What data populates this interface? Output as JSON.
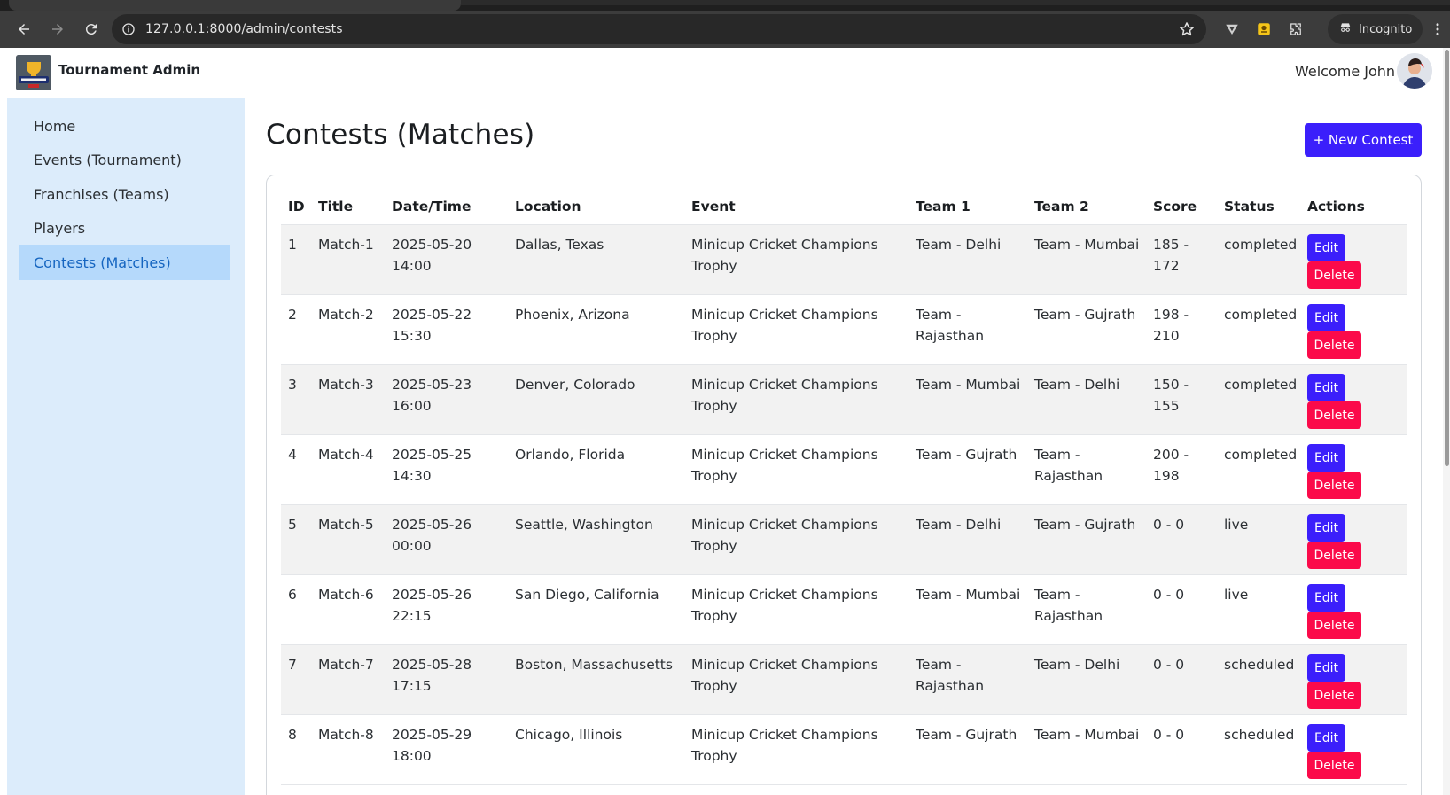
{
  "browser": {
    "url": "127.0.0.1:8000/admin/contests",
    "profile_label": "Incognito"
  },
  "header": {
    "brand": "Tournament Admin",
    "welcome": "Welcome John"
  },
  "sidebar": {
    "items": [
      {
        "label": "Home",
        "active": false
      },
      {
        "label": "Events (Tournament)",
        "active": false
      },
      {
        "label": "Franchises (Teams)",
        "active": false
      },
      {
        "label": "Players",
        "active": false
      },
      {
        "label": "Contests (Matches)",
        "active": true
      }
    ]
  },
  "main": {
    "title": "Contests (Matches)",
    "new_button": "+ New Contest",
    "table": {
      "headers": {
        "id": "ID",
        "title": "Title",
        "datetime": "Date/Time",
        "location": "Location",
        "event": "Event",
        "team1": "Team 1",
        "team2": "Team 2",
        "score": "Score",
        "status": "Status",
        "actions": "Actions"
      },
      "edit_label": "Edit",
      "delete_label": "Delete",
      "rows": [
        {
          "id": "1",
          "title": "Match-1",
          "date": "2025-05-20",
          "time": "14:00",
          "location": "Dallas, Texas",
          "event1": "Minicup Cricket Champions",
          "event2": "Trophy",
          "team1a": "Team - Delhi",
          "team1b": "",
          "team2a": "Team - Mumbai",
          "team2b": "",
          "scoreA": "185 -",
          "scoreB": "172",
          "status": "completed"
        },
        {
          "id": "2",
          "title": "Match-2",
          "date": "2025-05-22",
          "time": "15:30",
          "location": "Phoenix, Arizona",
          "event1": "Minicup Cricket Champions",
          "event2": "Trophy",
          "team1a": "Team -",
          "team1b": "Rajasthan",
          "team2a": "Team - Gujrath",
          "team2b": "",
          "scoreA": "198 -",
          "scoreB": "210",
          "status": "completed"
        },
        {
          "id": "3",
          "title": "Match-3",
          "date": "2025-05-23",
          "time": "16:00",
          "location": "Denver, Colorado",
          "event1": "Minicup Cricket Champions",
          "event2": "Trophy",
          "team1a": "Team - Mumbai",
          "team1b": "",
          "team2a": "Team - Delhi",
          "team2b": "",
          "scoreA": "150 -",
          "scoreB": "155",
          "status": "completed"
        },
        {
          "id": "4",
          "title": "Match-4",
          "date": "2025-05-25",
          "time": "14:30",
          "location": "Orlando, Florida",
          "event1": "Minicup Cricket Champions",
          "event2": "Trophy",
          "team1a": "Team - Gujrath",
          "team1b": "",
          "team2a": "Team -",
          "team2b": "Rajasthan",
          "scoreA": "200 -",
          "scoreB": "198",
          "status": "completed"
        },
        {
          "id": "5",
          "title": "Match-5",
          "date": "2025-05-26",
          "time": "00:00",
          "location": "Seattle, Washington",
          "event1": "Minicup Cricket Champions",
          "event2": "Trophy",
          "team1a": "Team - Delhi",
          "team1b": "",
          "team2a": "Team - Gujrath",
          "team2b": "",
          "scoreA": "0 - 0",
          "scoreB": "",
          "status": "live"
        },
        {
          "id": "6",
          "title": "Match-6",
          "date": "2025-05-26",
          "time": "22:15",
          "location": "San Diego, California",
          "event1": "Minicup Cricket Champions",
          "event2": "Trophy",
          "team1a": "Team - Mumbai",
          "team1b": "",
          "team2a": "Team -",
          "team2b": "Rajasthan",
          "scoreA": "0 - 0",
          "scoreB": "",
          "status": "live"
        },
        {
          "id": "7",
          "title": "Match-7",
          "date": "2025-05-28",
          "time": "17:15",
          "location": "Boston, Massachusetts",
          "event1": "Minicup Cricket Champions",
          "event2": "Trophy",
          "team1a": "Team -",
          "team1b": "Rajasthan",
          "team2a": "Team - Delhi",
          "team2b": "",
          "scoreA": "0 - 0",
          "scoreB": "",
          "status": "scheduled"
        },
        {
          "id": "8",
          "title": "Match-8",
          "date": "2025-05-29",
          "time": "18:00",
          "location": "Chicago, Illinois",
          "event1": "Minicup Cricket Champions",
          "event2": "Trophy",
          "team1a": "Team - Gujrath",
          "team1b": "",
          "team2a": "Team - Mumbai",
          "team2b": "",
          "scoreA": "0 - 0",
          "scoreB": "",
          "status": "scheduled"
        }
      ]
    }
  },
  "colors": {
    "primary": "#3b1ffb",
    "danger": "#fb0a4a",
    "sidebar_bg": "#dcecfb",
    "sidebar_active_bg": "#b5d9fb",
    "sidebar_active_text": "#1565c0",
    "row_stripe": "#f2f2f2"
  }
}
